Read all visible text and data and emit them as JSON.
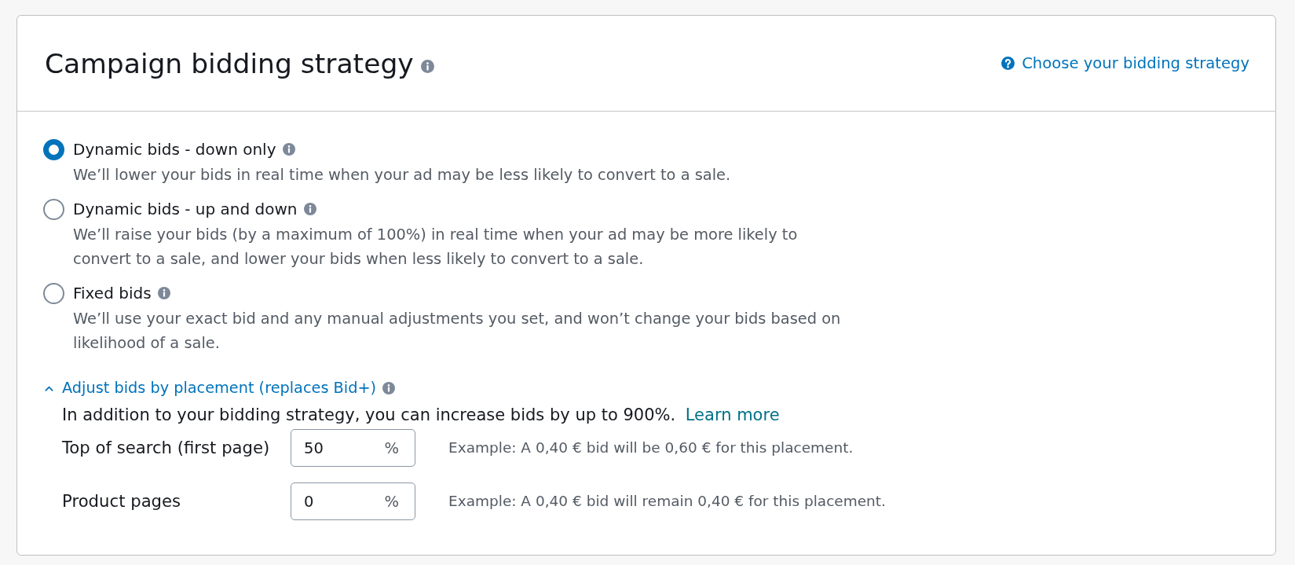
{
  "header": {
    "title": "Campaign bidding strategy",
    "help_link": "Choose your bidding strategy"
  },
  "strategies": [
    {
      "label": "Dynamic bids - down only",
      "description": "We’ll lower your bids in real time when your ad may be less likely to convert to a sale.",
      "selected": true
    },
    {
      "label": "Dynamic bids - up and down",
      "description": "We’ll raise your bids (by a maximum of 100%) in real time when your ad may be more likely to convert to a sale, and lower your bids when less likely to convert to a sale.",
      "selected": false
    },
    {
      "label": "Fixed bids",
      "description": "We’ll use your exact bid and any manual adjustments you set, and won’t change your bids based on likelihood of a sale.",
      "selected": false
    }
  ],
  "placement": {
    "title": "Adjust bids by placement (replaces Bid+)",
    "expanded": true,
    "intro": "In addition to your bidding strategy, you can increase bids by up to 900%.",
    "learn_more": "Learn more",
    "rows": [
      {
        "label": "Top of search (first page)",
        "value": "50",
        "unit": "%",
        "example": "Example: A 0,40 € bid will be 0,60 € for this placement."
      },
      {
        "label": "Product pages",
        "value": "0",
        "unit": "%",
        "example": "Example: A 0,40 € bid will remain 0,40 € for this placement."
      }
    ]
  }
}
